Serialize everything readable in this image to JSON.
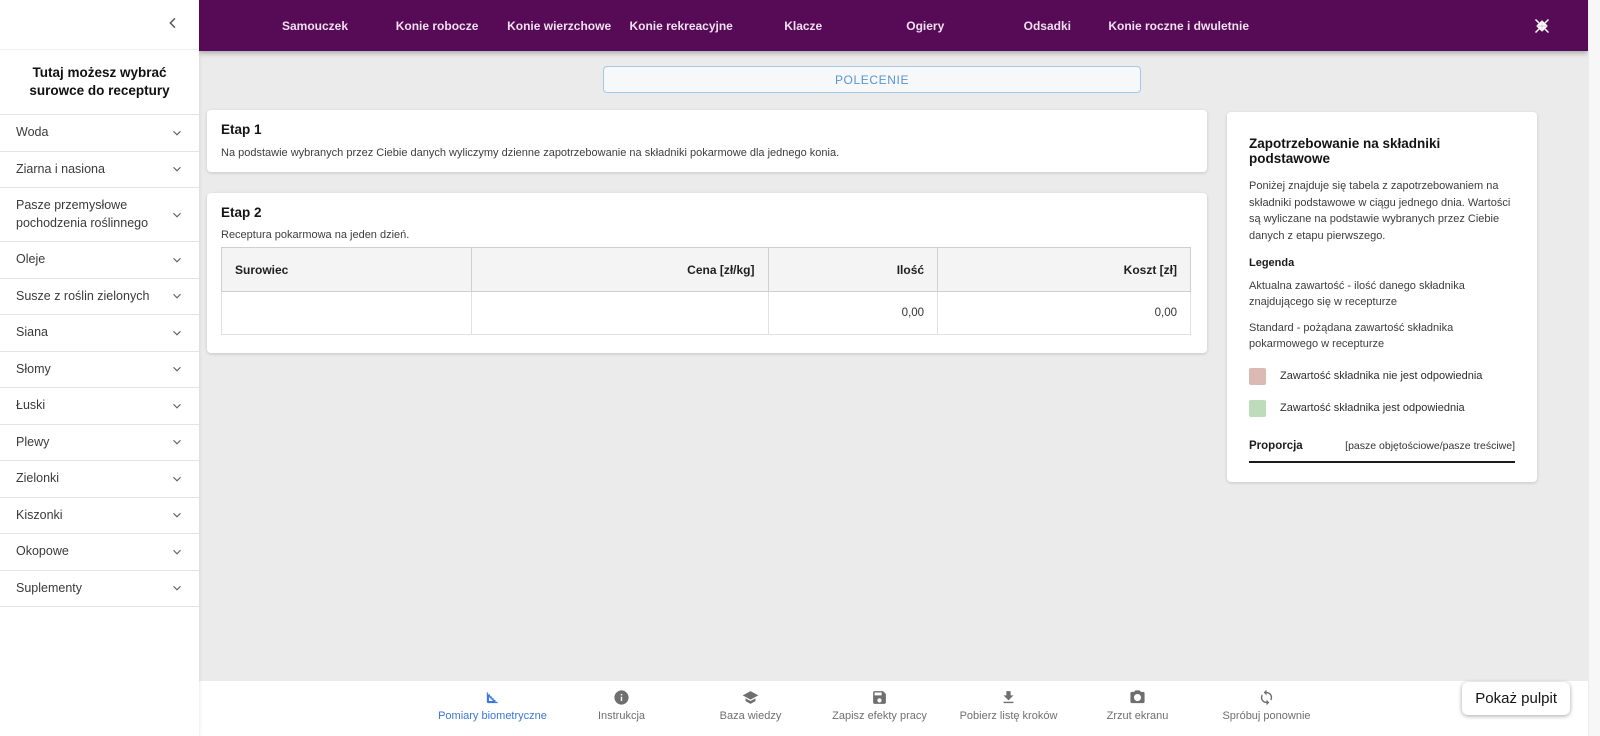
{
  "nav": {
    "items": [
      "Samouczek",
      "Konie robocze",
      "Konie wierzchowe",
      "Konie rekreacyjne",
      "Klacze",
      "Ogiery",
      "Odsadki",
      "Konie roczne i dwuletnie"
    ]
  },
  "sidebar": {
    "title": "Tutaj możesz wybrać surowce do receptury",
    "items": [
      {
        "label": "Woda"
      },
      {
        "label": "Ziarna i nasiona"
      },
      {
        "label": "Pasze przemysłowe pochodzenia roślinnego"
      },
      {
        "label": "Oleje"
      },
      {
        "label": "Susze z roślin zielonych"
      },
      {
        "label": "Siana"
      },
      {
        "label": "Słomy"
      },
      {
        "label": "Łuski"
      },
      {
        "label": "Plewy"
      },
      {
        "label": "Zielonki"
      },
      {
        "label": "Kiszonki"
      },
      {
        "label": "Okopowe"
      },
      {
        "label": "Suplementy"
      }
    ]
  },
  "main": {
    "command_button": "POLECENIE",
    "etap1": {
      "title": "Etap 1",
      "description": "Na podstawie wybranych przez Ciebie danych wyliczymy dzienne zapotrzebowanie na składniki pokarmowe dla jednego konia."
    },
    "etap2": {
      "title": "Etap 2",
      "subtitle": "Receptura pokarmowa na jeden dzień.",
      "table": {
        "headers": [
          "Surowiec",
          "Cena [zł/kg]",
          "Ilość",
          "Koszt [zł]"
        ],
        "rows": [
          [
            "",
            "",
            "0,00",
            "0,00"
          ]
        ]
      }
    }
  },
  "panel": {
    "title": "Zapotrzebowanie na składniki podstawowe",
    "description": "Poniżej znajduje się tabela z zapotrzebowaniem na składniki podstawowe w ciągu jednego dnia. Wartości są wyliczane na podstawie wybranych przez Ciebie danych z etapu pierwszego.",
    "legend_title": "Legenda",
    "legend_definitions": [
      "Aktualna zawartość - ilość danego składnika znajdującego się w recepturze",
      "Standard - pożądana zawartość składnika pokarmowego w recepturze"
    ],
    "legend_colors": [
      {
        "color": "#ddb9b5",
        "label": "Zawartość składnika nie jest odpowiednia"
      },
      {
        "color": "#bedcbb",
        "label": "Zawartość składnika jest odpowiednia"
      }
    ],
    "proporcja_label": "Proporcja",
    "proporcja_value": "[pasze objętościowe/pasze treściwe]"
  },
  "toolbar": {
    "items": [
      {
        "label": "Pomiary biometryczne",
        "icon": "ruler-icon",
        "active": true
      },
      {
        "label": "Instrukcja",
        "icon": "info-icon"
      },
      {
        "label": "Baza wiedzy",
        "icon": "graduation-cap-icon"
      },
      {
        "label": "Zapisz efekty pracy",
        "icon": "save-icon"
      },
      {
        "label": "Pobierz listę kroków",
        "icon": "download-icon"
      },
      {
        "label": "Zrzut ekranu",
        "icon": "camera-icon"
      },
      {
        "label": "Spróbuj ponownie",
        "icon": "refresh-icon"
      }
    ],
    "show_desktop_button": "Pokaż pulpit"
  },
  "colors": {
    "nav_purple": "#570b57",
    "accent_blue": "#5795d2",
    "toolbar_active_blue": "#3b76d9",
    "legend_pink": "#ddb9b5",
    "legend_green": "#bedcbb"
  }
}
